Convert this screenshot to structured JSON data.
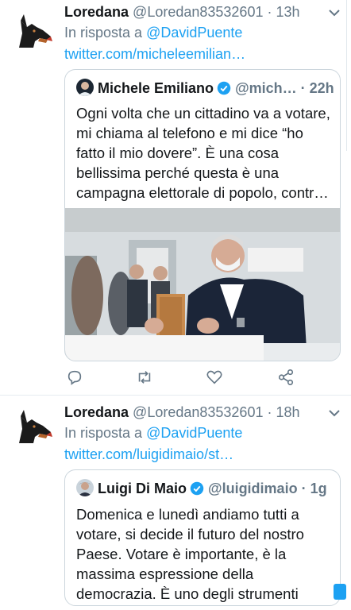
{
  "tweets": [
    {
      "name": "Loredana",
      "handle": "@Loredan83532601",
      "sep": " · ",
      "time": "13h",
      "reply_prefix": "In risposta a ",
      "reply_to": "@DavidPuente",
      "link": "twitter.com/micheleemilian…",
      "quote": {
        "name": "Michele Emiliano",
        "handle_time": "@mich… · 22h",
        "text": "Ogni volta che un cittadino va a votare, mi chiama al telefono e mi dice “ho fatto il mio dovere”. È una cosa bellissima perché questa è una campagna elettorale di popolo, contr…"
      }
    },
    {
      "name": "Loredana",
      "handle": "@Loredan83532601",
      "sep": " · ",
      "time": "18h",
      "reply_prefix": "In risposta a ",
      "reply_to": "@DavidPuente",
      "link": "twitter.com/luigidimaio/st…",
      "quote": {
        "name": "Luigi Di Maio",
        "handle_time": "@luigidimaio · 1g",
        "text": "Domenica e lunedì andiamo tutti a votare, si decide il futuro del nostro Paese. Votare è importante, è la massima espressione della democrazia. È uno degli strumenti pe…"
      }
    }
  ],
  "icons": {
    "reply": "reply-icon",
    "retweet": "retweet-icon",
    "like": "heart-icon",
    "share": "share-icon",
    "caret": "chevron-down-icon",
    "verified": "verified-badge-icon"
  },
  "colors": {
    "link": "#1da1f2",
    "secondary_text": "#657786",
    "primary_text": "#14171a",
    "border": "#ccd6dd"
  }
}
